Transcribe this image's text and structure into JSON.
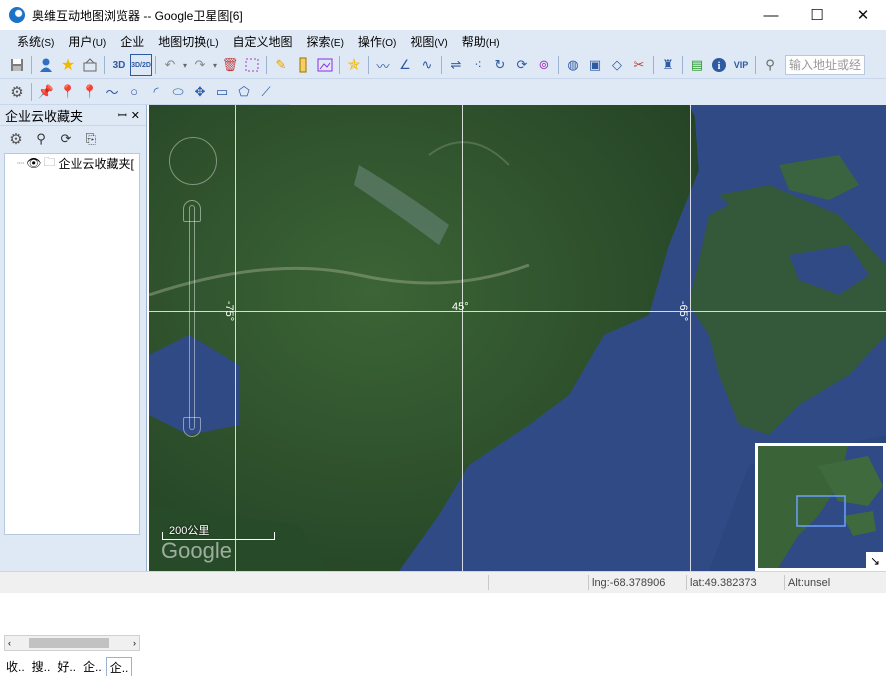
{
  "window": {
    "title": "奥维互动地图浏览器 -- Google卫星图[6]",
    "minimize": "—",
    "maximize": "☐",
    "close": "✕"
  },
  "menu": [
    {
      "label": "系统",
      "key": "(S)"
    },
    {
      "label": "用户",
      "key": "(U)"
    },
    {
      "label": "企业",
      "key": ""
    },
    {
      "label": "地图切换",
      "key": "(L)"
    },
    {
      "label": "自定义地图",
      "key": ""
    },
    {
      "label": "探索",
      "key": "(E)"
    },
    {
      "label": "操作",
      "key": "(O)"
    },
    {
      "label": "视图",
      "key": "(V)"
    },
    {
      "label": "帮助",
      "key": "(H)"
    }
  ],
  "toolbar": {
    "label_3d": "3D",
    "label_3d2d": "3D/2D",
    "label_vip": "VIP",
    "address_placeholder": "输入地址或经"
  },
  "panel": {
    "title": "企业云收藏夹",
    "pin": "ꟷ",
    "close": "✕",
    "tree_item": "企业云收藏夹[",
    "tabs": [
      "收..",
      "搜..",
      "好..",
      "企..",
      "企.."
    ]
  },
  "map": {
    "lat_label": "45°",
    "lon_label_left": "-75°",
    "lon_label_right": "-65°",
    "scale_label": "200公里",
    "watermark": "Google"
  },
  "status": {
    "lng": "lng:-68.378906",
    "lat": "lat:49.382373",
    "alt": "Alt:unsel"
  },
  "colors": {
    "chrome": "#dfe9f6",
    "ocean": "#2f4a84",
    "land": "#2c4f2c",
    "grid": "#ffffff"
  }
}
